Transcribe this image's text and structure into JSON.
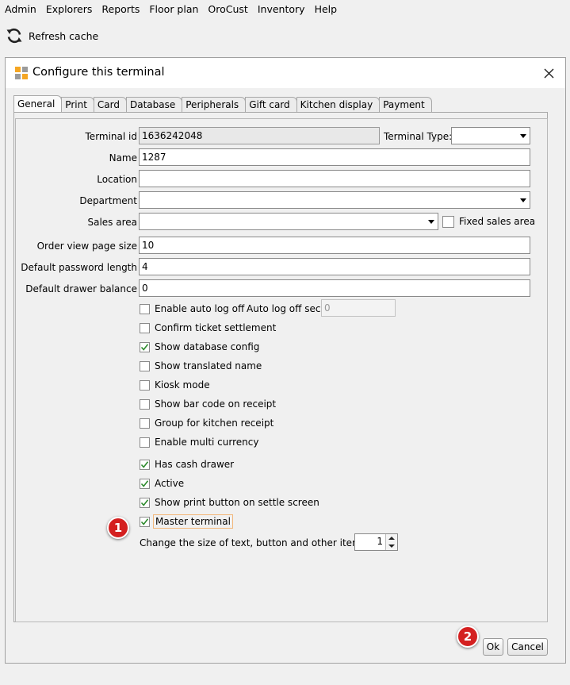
{
  "menubar": {
    "items": [
      "Admin",
      "Explorers",
      "Reports",
      "Floor plan",
      "OroCust",
      "Inventory",
      "Help"
    ]
  },
  "toolbar": {
    "refresh_label": "Refresh cache",
    "refresh_icon": "refresh-icon"
  },
  "dialog": {
    "title": "Configure this terminal",
    "tabs": [
      "General",
      "Print",
      "Card",
      "Database",
      "Peripherals",
      "Gift card",
      "Kitchen display",
      "Payment"
    ],
    "active_tab": "General",
    "fields": {
      "terminal_id": {
        "label": "Terminal id",
        "value": "1636242048"
      },
      "terminal_type": {
        "label": "Terminal Type:",
        "value": ""
      },
      "name": {
        "label": "Name",
        "value": "1287"
      },
      "location": {
        "label": "Location",
        "value": ""
      },
      "department": {
        "label": "Department",
        "value": ""
      },
      "sales_area": {
        "label": "Sales area",
        "value": ""
      },
      "fixed_sales_area": {
        "label": "Fixed sales area",
        "checked": false
      },
      "order_view_page_size": {
        "label": "Order view page size",
        "value": "10"
      },
      "default_password_length": {
        "label": "Default password length",
        "value": "4"
      },
      "default_drawer_balance": {
        "label": "Default drawer balance",
        "value": "0"
      },
      "auto_log_off_sec": {
        "label": "Auto log off sec",
        "value": "0"
      }
    },
    "checkboxes": [
      {
        "label": "Enable auto log off",
        "checked": false
      },
      {
        "label": "Confirm ticket settlement",
        "checked": false
      },
      {
        "label": "Show database config",
        "checked": true
      },
      {
        "label": "Show translated name",
        "checked": false
      },
      {
        "label": "Kiosk mode",
        "checked": false
      },
      {
        "label": "Show bar code on receipt",
        "checked": false
      },
      {
        "label": "Group for kitchen receipt",
        "checked": false
      },
      {
        "label": "Enable multi currency",
        "checked": false
      },
      {
        "label": "Has cash drawer",
        "checked": true
      },
      {
        "label": "Active",
        "checked": true
      },
      {
        "label": "Show print button on settle screen",
        "checked": true
      },
      {
        "label": "Master terminal",
        "checked": true
      }
    ],
    "size_setting": {
      "label": "Change the size of text, button and other items",
      "value": "1"
    },
    "buttons": {
      "ok": "Ok",
      "cancel": "Cancel"
    }
  },
  "annotations": {
    "badge_1": "1",
    "badge_2": "2"
  },
  "colors": {
    "badge": "#d42020",
    "check": "#2e8b2e",
    "focus_outline": "#f2b77a"
  }
}
